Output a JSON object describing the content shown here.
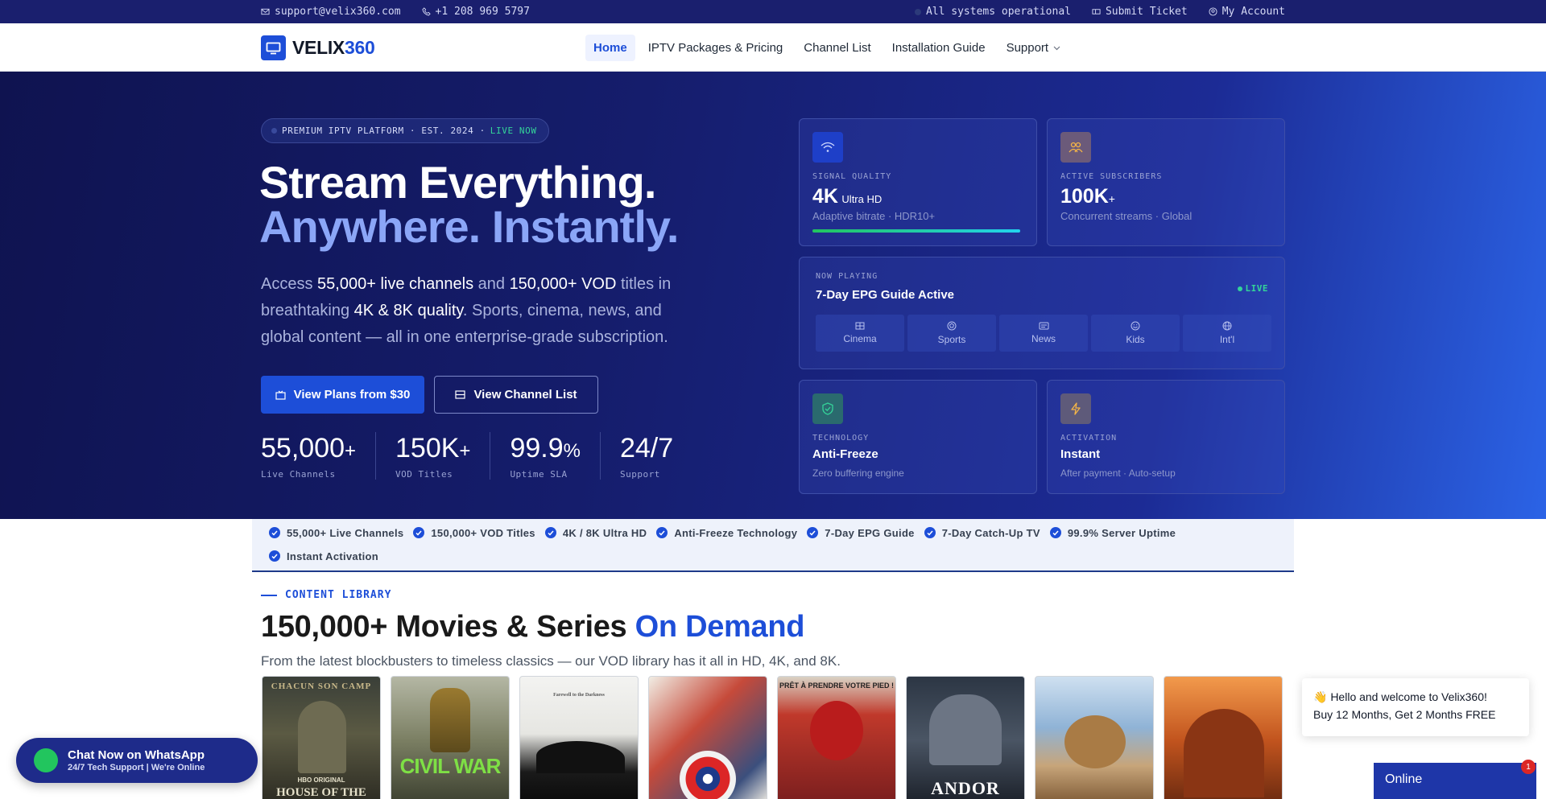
{
  "topbar": {
    "email": "support@velix360.com",
    "phone": "+1 208 969 5797",
    "status": "All systems operational",
    "submit_ticket": "Submit Ticket",
    "my_account": "My Account"
  },
  "nav": {
    "logo_main": "VELIX",
    "logo_accent": "360",
    "links": [
      "Home",
      "IPTV Packages & Pricing",
      "Channel List",
      "Installation Guide",
      "Support"
    ],
    "active": "Home"
  },
  "hero": {
    "badge": "PREMIUM IPTV PLATFORM · EST. 2024 ·",
    "badge_live": "LIVE NOW",
    "title_line1": "Stream Everything.",
    "title_line2": "Anywhere. Instantly.",
    "lead": {
      "p1": "Access ",
      "b1": "55,000+ live channels",
      "p2": " and ",
      "b2": "150,000+ VOD",
      "p3": " titles in breathtaking ",
      "b3": "4K & 8K quality",
      "p4": ". Sports, cinema, news, and global content — all in one enterprise-grade subscription."
    },
    "btn_primary": "View Plans from $30",
    "btn_secondary": "View Channel List",
    "stats": [
      {
        "value": "55,000",
        "suffix": "+",
        "label": "Live Channels"
      },
      {
        "value": "150K",
        "suffix": "+",
        "label": "VOD Titles"
      },
      {
        "value": "99.9",
        "suffix": "%",
        "label": "Uptime SLA"
      },
      {
        "value": "24/7",
        "suffix": "",
        "label": "Support"
      }
    ]
  },
  "cards": {
    "signal": {
      "caption": "SIGNAL QUALITY",
      "value": "4K",
      "value_suffix": "Ultra HD",
      "sub": "Adaptive bitrate · HDR10+",
      "level": 1.0
    },
    "subscribers": {
      "caption": "ACTIVE SUBSCRIBERS",
      "value": "100K",
      "value_suffix": "+",
      "sub": "Concurrent streams · Global"
    },
    "now_playing": {
      "caption": "NOW PLAYING",
      "title": "7-Day EPG Guide Active",
      "live": "LIVE",
      "categories": [
        "Cinema",
        "Sports",
        "News",
        "Kids",
        "Int'l"
      ]
    },
    "technology": {
      "caption": "TECHNOLOGY",
      "value": "Anti-Freeze",
      "sub": "Zero buffering engine"
    },
    "activation": {
      "caption": "ACTIVATION",
      "value": "Instant",
      "sub": "After payment · Auto-setup"
    }
  },
  "features": [
    "55,000+ Live Channels",
    "150,000+ VOD Titles",
    "4K / 8K Ultra HD",
    "Anti-Freeze Technology",
    "7-Day EPG Guide",
    "7-Day Catch-Up TV",
    "99.9% Server Uptime",
    "Instant Activation"
  ],
  "library": {
    "eyebrow": "CONTENT LIBRARY",
    "title": "150,000+ Movies & Series",
    "title_accent": "On Demand",
    "desc": "From the latest blockbusters to timeless classics — our VOD library has it all in HD, 4K, and 8K.",
    "posters": [
      {
        "top_text": "CHACUN SON CAMP",
        "bottom_text": "HOUSE OF THE",
        "extra": "HBO ORIGINAL"
      },
      {
        "top_text": "",
        "bottom_text": "CIVIL WAR",
        "extra": ""
      },
      {
        "top_text": "Farewell to the Darkness",
        "bottom_text": "",
        "extra": ""
      },
      {
        "top_text": "",
        "bottom_text": "",
        "extra": ""
      },
      {
        "top_text": "PRÊT À PRENDRE VOTRE PIED !",
        "bottom_text": "",
        "extra": ""
      },
      {
        "top_text": "",
        "bottom_text": "ANDOR",
        "extra": ""
      },
      {
        "top_text": "",
        "bottom_text": "",
        "extra": ""
      },
      {
        "top_text": "",
        "bottom_text": "",
        "extra": ""
      }
    ]
  },
  "widgets": {
    "whatsapp_title": "Chat Now on WhatsApp",
    "whatsapp_sub": "24/7 Tech Support | We're Online",
    "popup_line1": "👋 Hello and welcome to Velix360!",
    "popup_line2": "Buy 12 Months, Get 2 Months FREE",
    "online": "Online",
    "online_count": "1"
  },
  "colors": {
    "accent": "#1d4ed8",
    "live": "#34d399",
    "hero_dark": "#0f1350",
    "hero_light": "#2b63e6"
  }
}
